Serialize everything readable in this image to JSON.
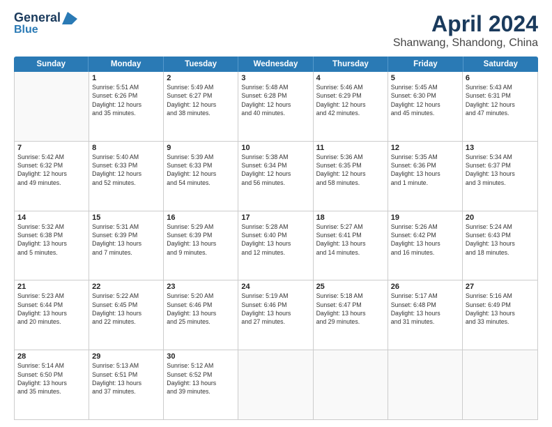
{
  "header": {
    "logo_line1": "General",
    "logo_line2": "Blue",
    "title": "April 2024",
    "subtitle": "Shanwang, Shandong, China"
  },
  "days_of_week": [
    "Sunday",
    "Monday",
    "Tuesday",
    "Wednesday",
    "Thursday",
    "Friday",
    "Saturday"
  ],
  "weeks": [
    [
      {
        "day": "",
        "info": ""
      },
      {
        "day": "1",
        "info": "Sunrise: 5:51 AM\nSunset: 6:26 PM\nDaylight: 12 hours\nand 35 minutes."
      },
      {
        "day": "2",
        "info": "Sunrise: 5:49 AM\nSunset: 6:27 PM\nDaylight: 12 hours\nand 38 minutes."
      },
      {
        "day": "3",
        "info": "Sunrise: 5:48 AM\nSunset: 6:28 PM\nDaylight: 12 hours\nand 40 minutes."
      },
      {
        "day": "4",
        "info": "Sunrise: 5:46 AM\nSunset: 6:29 PM\nDaylight: 12 hours\nand 42 minutes."
      },
      {
        "day": "5",
        "info": "Sunrise: 5:45 AM\nSunset: 6:30 PM\nDaylight: 12 hours\nand 45 minutes."
      },
      {
        "day": "6",
        "info": "Sunrise: 5:43 AM\nSunset: 6:31 PM\nDaylight: 12 hours\nand 47 minutes."
      }
    ],
    [
      {
        "day": "7",
        "info": "Sunrise: 5:42 AM\nSunset: 6:32 PM\nDaylight: 12 hours\nand 49 minutes."
      },
      {
        "day": "8",
        "info": "Sunrise: 5:40 AM\nSunset: 6:33 PM\nDaylight: 12 hours\nand 52 minutes."
      },
      {
        "day": "9",
        "info": "Sunrise: 5:39 AM\nSunset: 6:33 PM\nDaylight: 12 hours\nand 54 minutes."
      },
      {
        "day": "10",
        "info": "Sunrise: 5:38 AM\nSunset: 6:34 PM\nDaylight: 12 hours\nand 56 minutes."
      },
      {
        "day": "11",
        "info": "Sunrise: 5:36 AM\nSunset: 6:35 PM\nDaylight: 12 hours\nand 58 minutes."
      },
      {
        "day": "12",
        "info": "Sunrise: 5:35 AM\nSunset: 6:36 PM\nDaylight: 13 hours\nand 1 minute."
      },
      {
        "day": "13",
        "info": "Sunrise: 5:34 AM\nSunset: 6:37 PM\nDaylight: 13 hours\nand 3 minutes."
      }
    ],
    [
      {
        "day": "14",
        "info": "Sunrise: 5:32 AM\nSunset: 6:38 PM\nDaylight: 13 hours\nand 5 minutes."
      },
      {
        "day": "15",
        "info": "Sunrise: 5:31 AM\nSunset: 6:39 PM\nDaylight: 13 hours\nand 7 minutes."
      },
      {
        "day": "16",
        "info": "Sunrise: 5:29 AM\nSunset: 6:39 PM\nDaylight: 13 hours\nand 9 minutes."
      },
      {
        "day": "17",
        "info": "Sunrise: 5:28 AM\nSunset: 6:40 PM\nDaylight: 13 hours\nand 12 minutes."
      },
      {
        "day": "18",
        "info": "Sunrise: 5:27 AM\nSunset: 6:41 PM\nDaylight: 13 hours\nand 14 minutes."
      },
      {
        "day": "19",
        "info": "Sunrise: 5:26 AM\nSunset: 6:42 PM\nDaylight: 13 hours\nand 16 minutes."
      },
      {
        "day": "20",
        "info": "Sunrise: 5:24 AM\nSunset: 6:43 PM\nDaylight: 13 hours\nand 18 minutes."
      }
    ],
    [
      {
        "day": "21",
        "info": "Sunrise: 5:23 AM\nSunset: 6:44 PM\nDaylight: 13 hours\nand 20 minutes."
      },
      {
        "day": "22",
        "info": "Sunrise: 5:22 AM\nSunset: 6:45 PM\nDaylight: 13 hours\nand 22 minutes."
      },
      {
        "day": "23",
        "info": "Sunrise: 5:20 AM\nSunset: 6:46 PM\nDaylight: 13 hours\nand 25 minutes."
      },
      {
        "day": "24",
        "info": "Sunrise: 5:19 AM\nSunset: 6:46 PM\nDaylight: 13 hours\nand 27 minutes."
      },
      {
        "day": "25",
        "info": "Sunrise: 5:18 AM\nSunset: 6:47 PM\nDaylight: 13 hours\nand 29 minutes."
      },
      {
        "day": "26",
        "info": "Sunrise: 5:17 AM\nSunset: 6:48 PM\nDaylight: 13 hours\nand 31 minutes."
      },
      {
        "day": "27",
        "info": "Sunrise: 5:16 AM\nSunset: 6:49 PM\nDaylight: 13 hours\nand 33 minutes."
      }
    ],
    [
      {
        "day": "28",
        "info": "Sunrise: 5:14 AM\nSunset: 6:50 PM\nDaylight: 13 hours\nand 35 minutes."
      },
      {
        "day": "29",
        "info": "Sunrise: 5:13 AM\nSunset: 6:51 PM\nDaylight: 13 hours\nand 37 minutes."
      },
      {
        "day": "30",
        "info": "Sunrise: 5:12 AM\nSunset: 6:52 PM\nDaylight: 13 hours\nand 39 minutes."
      },
      {
        "day": "",
        "info": ""
      },
      {
        "day": "",
        "info": ""
      },
      {
        "day": "",
        "info": ""
      },
      {
        "day": "",
        "info": ""
      }
    ]
  ]
}
